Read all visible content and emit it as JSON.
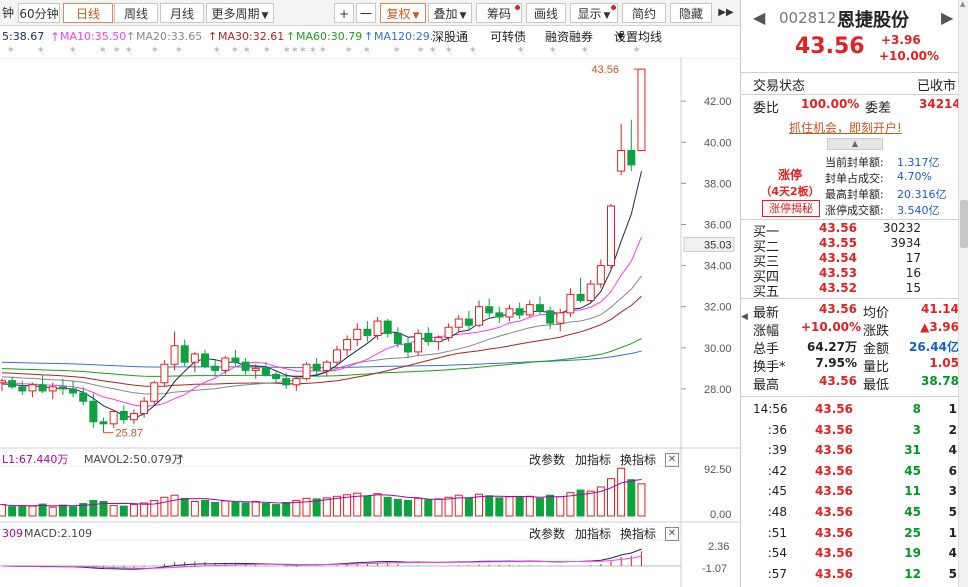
{
  "toolbar": {
    "items": [
      {
        "label": "钟",
        "w": 0
      },
      {
        "label": "60分钟"
      },
      {
        "label": "日线",
        "active": true
      },
      {
        "label": "周线"
      },
      {
        "label": "月线"
      },
      {
        "label": "更多周期"
      },
      {
        "label": "+"
      },
      {
        "label": "一"
      },
      {
        "label": "复权"
      },
      {
        "label": "叠加"
      },
      {
        "label": "筹码"
      },
      {
        "label": "画线"
      },
      {
        "label": "显示"
      },
      {
        "label": "简约"
      },
      {
        "label": "隐藏"
      }
    ]
  },
  "ma_legend": {
    "ma5": "5:38.67",
    "ma10": "MA10:35.50",
    "ma20": "MA20:33.65",
    "ma30": "MA30:32.61",
    "ma60": "MA60:30.79",
    "ma120": "MA120:29.",
    "buttons": [
      "深股通",
      "可转债",
      "融资融券",
      "设置均线"
    ]
  },
  "colors": {
    "up": "#e5201f",
    "down": "#0aa33e",
    "ma5": "#1b2a57",
    "ma10": "#ff3cff",
    "ma20": "#888888",
    "ma30": "#b22222",
    "ma60": "#1aa21a",
    "ma120": "#2f78c8",
    "accent": "#d2561f"
  },
  "chart_data": {
    "type": "candlestick",
    "y_axis_labels": [
      "42.00",
      "40.00",
      "38.00",
      "36.00",
      "34.00",
      "32.00",
      "30.00",
      "28.00"
    ],
    "current_price_tag": "35.03",
    "max_annotation": "43.56",
    "min_annotation": "25.87",
    "ohlc": [
      [
        28.3,
        28.5,
        27.9,
        28.4
      ],
      [
        28.4,
        28.6,
        28.0,
        28.1
      ],
      [
        28.1,
        28.4,
        27.7,
        27.9
      ],
      [
        27.9,
        28.3,
        27.6,
        28.2
      ],
      [
        28.2,
        28.7,
        27.8,
        27.9
      ],
      [
        27.9,
        28.3,
        27.5,
        28.1
      ],
      [
        28.1,
        28.5,
        27.7,
        28.0
      ],
      [
        28.0,
        28.4,
        27.6,
        27.8
      ],
      [
        27.8,
        28.1,
        27.2,
        27.4
      ],
      [
        27.4,
        27.8,
        26.1,
        26.4
      ],
      [
        26.4,
        26.6,
        25.87,
        26.3
      ],
      [
        26.3,
        27.0,
        26.1,
        26.9
      ],
      [
        26.9,
        27.2,
        26.3,
        26.5
      ],
      [
        26.5,
        27.0,
        26.3,
        26.8
      ],
      [
        26.8,
        27.6,
        26.6,
        27.4
      ],
      [
        27.4,
        28.4,
        27.2,
        28.3
      ],
      [
        28.3,
        29.4,
        28.1,
        29.2
      ],
      [
        29.2,
        30.8,
        28.9,
        30.1
      ],
      [
        30.1,
        30.4,
        29.1,
        29.3
      ],
      [
        29.3,
        29.8,
        28.8,
        29.7
      ],
      [
        29.7,
        29.9,
        29.0,
        29.1
      ],
      [
        29.1,
        29.4,
        28.6,
        28.9
      ],
      [
        28.9,
        29.6,
        28.7,
        29.5
      ],
      [
        29.5,
        29.9,
        29.1,
        29.3
      ],
      [
        29.3,
        29.5,
        28.7,
        28.9
      ],
      [
        28.9,
        29.2,
        28.5,
        29.0
      ],
      [
        29.0,
        29.3,
        28.6,
        28.7
      ],
      [
        28.7,
        28.9,
        28.3,
        28.5
      ],
      [
        28.5,
        28.8,
        28.0,
        28.2
      ],
      [
        28.2,
        28.6,
        27.9,
        28.5
      ],
      [
        28.5,
        29.3,
        28.4,
        29.2
      ],
      [
        29.2,
        29.5,
        28.7,
        28.9
      ],
      [
        28.9,
        29.4,
        28.6,
        29.3
      ],
      [
        29.3,
        30.1,
        29.1,
        29.9
      ],
      [
        29.9,
        30.6,
        29.6,
        30.4
      ],
      [
        30.4,
        31.2,
        30.1,
        30.9
      ],
      [
        30.9,
        31.3,
        30.3,
        30.6
      ],
      [
        30.6,
        31.5,
        30.4,
        31.3
      ],
      [
        31.3,
        31.4,
        30.5,
        30.7
      ],
      [
        30.7,
        31.0,
        30.0,
        30.2
      ],
      [
        30.2,
        30.5,
        29.5,
        29.8
      ],
      [
        29.8,
        30.9,
        29.6,
        30.7
      ],
      [
        30.7,
        31.0,
        30.1,
        30.3
      ],
      [
        30.3,
        30.6,
        29.9,
        30.5
      ],
      [
        30.5,
        31.2,
        30.3,
        31.0
      ],
      [
        31.0,
        31.6,
        30.8,
        31.4
      ],
      [
        31.4,
        31.8,
        30.9,
        31.1
      ],
      [
        31.1,
        32.3,
        31.0,
        32.0
      ],
      [
        32.0,
        32.4,
        31.5,
        31.7
      ],
      [
        31.7,
        32.0,
        31.2,
        31.5
      ],
      [
        31.5,
        32.1,
        31.3,
        31.9
      ],
      [
        31.9,
        32.2,
        31.4,
        31.6
      ],
      [
        31.6,
        32.3,
        31.5,
        32.1
      ],
      [
        32.1,
        32.5,
        31.6,
        31.8
      ],
      [
        31.8,
        32.0,
        30.9,
        31.2
      ],
      [
        31.2,
        31.9,
        30.8,
        31.7
      ],
      [
        31.7,
        32.9,
        31.5,
        32.6
      ],
      [
        32.6,
        33.4,
        32.2,
        32.3
      ],
      [
        32.3,
        33.3,
        32.2,
        33.1
      ],
      [
        33.1,
        34.3,
        32.9,
        34.0
      ],
      [
        34.0,
        37.0,
        33.8,
        36.9
      ],
      [
        38.6,
        40.9,
        38.4,
        39.6
      ],
      [
        39.6,
        41.1,
        38.6,
        38.9
      ],
      [
        39.6,
        43.56,
        39.6,
        43.56
      ]
    ],
    "volume": [
      22,
      18,
      20,
      19,
      23,
      17,
      21,
      18,
      24,
      30,
      28,
      20,
      19,
      22,
      25,
      30,
      36,
      40,
      34,
      28,
      30,
      26,
      29,
      27,
      25,
      28,
      24,
      22,
      26,
      30,
      34,
      33,
      35,
      38,
      41,
      44,
      38,
      43,
      36,
      32,
      30,
      34,
      31,
      33,
      36,
      40,
      35,
      42,
      39,
      35,
      37,
      36,
      38,
      34,
      40,
      37,
      45,
      50,
      48,
      56,
      72,
      92,
      70,
      62
    ],
    "volume_axis": [
      "92.50",
      "0.00"
    ],
    "macd_axis": [
      "2.36",
      "-1.07"
    ]
  },
  "vol_legend": {
    "vol": "L1:67.440万",
    "mavol2": "MAVOL2:50.079万",
    "buttons": [
      "改参数",
      "加指标",
      "换指标"
    ]
  },
  "macd_legend": {
    "left": "309",
    "macd": "MACD:2.109",
    "buttons": [
      "改参数",
      "加指标",
      "换指标"
    ]
  },
  "stock": {
    "code": "002812",
    "name": "恩捷股份",
    "price": "43.56",
    "change": "+3.96",
    "pct": "+10.00%",
    "trade_status_label": "交易状态",
    "trade_status": "已收市",
    "weibi_label": "委比",
    "weibi": "100.00%",
    "weicha_label": "委差",
    "weicha": "34214",
    "promo": "抓住机会，即刻开户!",
    "limit_title": "涨停",
    "limit_sub": "（4天2板）",
    "limit_link": "涨停揭秘",
    "limit_stats": [
      {
        "label": "当前封单额:",
        "value": "1.317亿"
      },
      {
        "label": "封单占成交:",
        "value": "4.70%"
      },
      {
        "label": "最高封单额:",
        "value": "20.316亿"
      },
      {
        "label": "涨停成交额:",
        "value": "3.540亿"
      }
    ],
    "bids": [
      {
        "label": "买一",
        "price": "43.56",
        "vol": "30232"
      },
      {
        "label": "买二",
        "price": "43.55",
        "vol": "3934"
      },
      {
        "label": "买三",
        "price": "43.54",
        "vol": "17"
      },
      {
        "label": "买四",
        "price": "43.53",
        "vol": "16"
      },
      {
        "label": "买五",
        "price": "43.52",
        "vol": "15"
      }
    ],
    "stats": [
      {
        "l1": "最新",
        "v1": "43.56",
        "c1": "red",
        "l2": "均价",
        "v2": "41.14",
        "c2": "red"
      },
      {
        "l1": "涨幅",
        "v1": "+10.00%",
        "c1": "red",
        "l2": "涨跌",
        "v2": "▲3.96",
        "c2": "red"
      },
      {
        "l1": "总手",
        "v1": "64.27万",
        "c1": "",
        "l2": "金额",
        "v2": "26.44亿",
        "c2": "blue"
      },
      {
        "l1": "换手*",
        "v1": "7.95%",
        "c1": "",
        "l2": "量比",
        "v2": "1.05",
        "c2": "red"
      },
      {
        "l1": "最高",
        "v1": "43.56",
        "c1": "red",
        "l2": "最低",
        "v2": "38.78",
        "c2": "green"
      }
    ],
    "ticks": [
      {
        "t": "14:56",
        "p": "43.56",
        "v": "8",
        "n": "1"
      },
      {
        "t": ":36",
        "p": "43.56",
        "v": "3",
        "n": "2"
      },
      {
        "t": ":39",
        "p": "43.56",
        "v": "31",
        "n": "4"
      },
      {
        "t": ":42",
        "p": "43.56",
        "v": "45",
        "n": "6"
      },
      {
        "t": ":45",
        "p": "43.56",
        "v": "11",
        "n": "3"
      },
      {
        "t": ":48",
        "p": "43.56",
        "v": "45",
        "n": "5"
      },
      {
        "t": ":51",
        "p": "43.56",
        "v": "25",
        "n": "1"
      },
      {
        "t": ":54",
        "p": "43.56",
        "v": "19",
        "n": "4"
      },
      {
        "t": ":57",
        "p": "43.56",
        "v": "12",
        "n": "5"
      }
    ]
  }
}
